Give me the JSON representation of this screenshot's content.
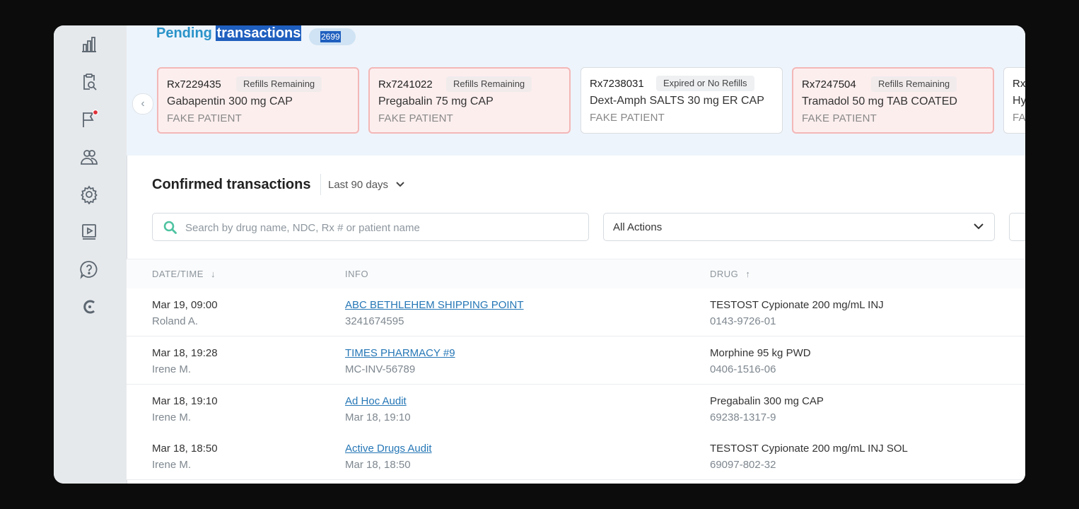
{
  "pending": {
    "title_part1": "Pending",
    "title_part2": "transactions",
    "count": "2699",
    "cards": [
      {
        "rx": "Rx7229435",
        "status": "Refills Remaining",
        "drug": "Gabapentin 300 mg CAP",
        "patient": "FAKE PATIENT",
        "style": "alert"
      },
      {
        "rx": "Rx7241022",
        "status": "Refills Remaining",
        "drug": "Pregabalin 75 mg CAP",
        "patient": "FAKE PATIENT",
        "style": "alert"
      },
      {
        "rx": "Rx7238031",
        "status": "Expired or No Refills",
        "drug": "Dext-Amph SALTS 30 mg ER CAP",
        "patient": "FAKE PATIENT",
        "style": "neutral"
      },
      {
        "rx": "Rx7247504",
        "status": "Refills Remaining",
        "drug": "Tramadol 50 mg TAB COATED",
        "patient": "FAKE PATIENT",
        "style": "alert"
      },
      {
        "rx": "Rx",
        "status": "",
        "drug": "Hy",
        "patient": "FA",
        "style": "neutral"
      }
    ]
  },
  "confirmed": {
    "title": "Confirmed transactions",
    "range": "Last 90 days",
    "search_placeholder": "Search by drug name, NDC, Rx # or patient name",
    "actions_value": "All Actions",
    "columns": {
      "datetime": "DATE/TIME",
      "info": "INFO",
      "drug": "DRUG"
    },
    "rows": [
      {
        "date": "Mar 19, 09:00",
        "user": "Roland A.",
        "info": "ABC BETHLEHEM SHIPPING POINT",
        "info_sub": "3241674595",
        "drug": "TESTOST Cypionate 200 mg/mL INJ",
        "ndc": "0143-9726-01"
      },
      {
        "date": "Mar 18, 19:28",
        "user": "Irene M.",
        "info": "TIMES PHARMACY #9",
        "info_sub": "MC-INV-56789",
        "drug": "Morphine 95 kg PWD",
        "ndc": "0406-1516-06"
      },
      {
        "date": "Mar 18, 19:10",
        "user": "Irene M.",
        "info": "Ad Hoc Audit",
        "info_sub": "Mar 18, 19:10",
        "drug": "Pregabalin 300 mg CAP",
        "ndc": "69238-1317-9"
      },
      {
        "date": "Mar 18, 18:50",
        "user": "Irene M.",
        "info": "Active Drugs Audit",
        "info_sub": "Mar 18, 18:50",
        "drug": "TESTOST Cypionate 200 mg/mL INJ SOL",
        "ndc": "69097-802-32"
      }
    ]
  },
  "colors": {
    "accent": "#2a93c9",
    "link": "#2677b6",
    "alert_bg": "#fdeeee",
    "alert_border": "#f3b7b7",
    "notification": "#e0313a"
  }
}
